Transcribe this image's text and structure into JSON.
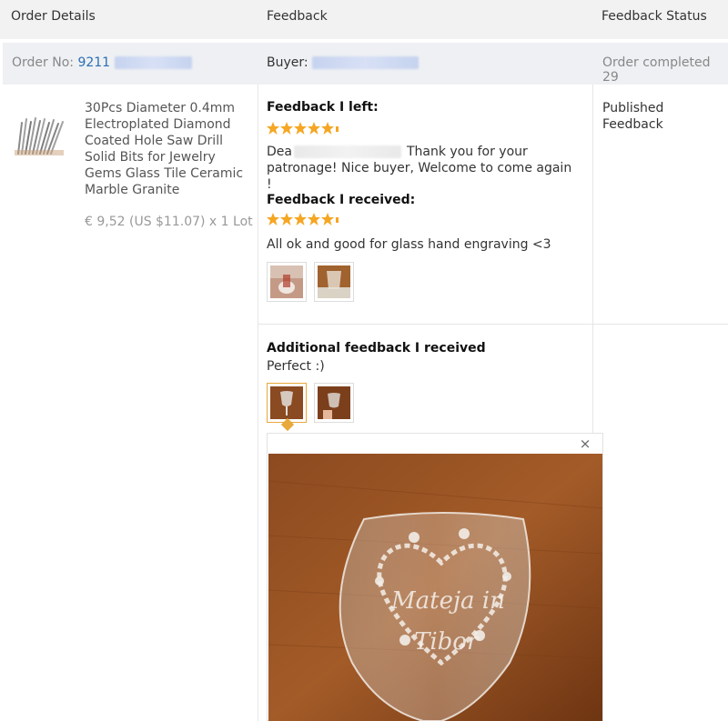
{
  "header": {
    "order_details": "Order Details",
    "feedback": "Feedback",
    "feedback_status": "Feedback Status"
  },
  "order": {
    "order_no_label": "Order No:",
    "order_no_value": "9211",
    "buyer_label": "Buyer:",
    "status_text": "Order completed 29"
  },
  "product": {
    "title_lines": [
      "30Pcs Diameter 0.4mm",
      "Electroplated Diamond",
      "Coated Hole Saw Drill",
      "Solid Bits for Jewelry",
      "Gems Glass Tile Ceramic",
      "Marble Granite"
    ],
    "price": "€ 9,52 (US $11.07) x 1 Lot"
  },
  "feedback_left": {
    "heading": "Feedback I left:",
    "rating": 5,
    "text_start": "Dea",
    "text_end": "Thank you for your",
    "text_line2": "patronage! Nice buyer, Welcome to come again !"
  },
  "feedback_received": {
    "heading": "Feedback I received:",
    "rating": 5,
    "text": "All ok and good for glass hand engraving <3"
  },
  "additional_feedback": {
    "heading": "Additional feedback I received",
    "text": "Perfect :)"
  },
  "status": {
    "line1": "Published",
    "line2": "Feedback"
  },
  "preview": {
    "close": "×"
  },
  "colors": {
    "star": "#f5a623",
    "link": "#2a6fb5",
    "active_border": "#e8a83a"
  }
}
